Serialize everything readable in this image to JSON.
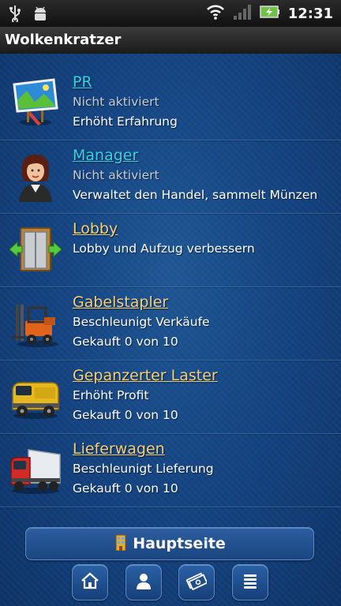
{
  "status_bar": {
    "time": "12:31",
    "icons": [
      "usb-icon",
      "android-debug-icon",
      "wifi-icon",
      "signal-icon",
      "battery-charging-icon"
    ]
  },
  "app": {
    "title": "Wolkenkratzer"
  },
  "upgrades": [
    {
      "name": "PR",
      "lines": [
        "Nicht aktiviert",
        "Erhöht Erfahrung"
      ],
      "icon": "billboard-icon",
      "name_color": "#35d3e6"
    },
    {
      "name": "Manager",
      "lines": [
        "Nicht aktiviert",
        "Verwaltet den Handel, sammelt Münzen"
      ],
      "icon": "manager-woman-icon",
      "name_color": "#35d3e6"
    },
    {
      "name": "Lobby",
      "lines": [
        "Lobby und Aufzug verbessern"
      ],
      "icon": "elevator-icon",
      "name_color": "#f4d07a"
    },
    {
      "name": "Gabelstapler",
      "lines": [
        "Beschleunigt Verkäufe",
        "Gekauft 0 von 10"
      ],
      "icon": "forklift-icon",
      "name_color": "#f4d07a"
    },
    {
      "name": "Gepanzerter Laster",
      "lines": [
        "Erhöht Profit",
        "Gekauft 0 von 10"
      ],
      "icon": "armored-truck-icon",
      "name_color": "#f4d07a"
    },
    {
      "name": "Lieferwagen",
      "lines": [
        "Beschleunigt Lieferung",
        "Gekauft 0 von 10"
      ],
      "icon": "delivery-truck-icon",
      "name_color": "#f4d07a"
    }
  ],
  "home_button": {
    "label": "Hauptseite",
    "icon": "building-icon"
  },
  "nav": [
    "home-icon",
    "person-icon",
    "money-icon",
    "list-icon"
  ]
}
